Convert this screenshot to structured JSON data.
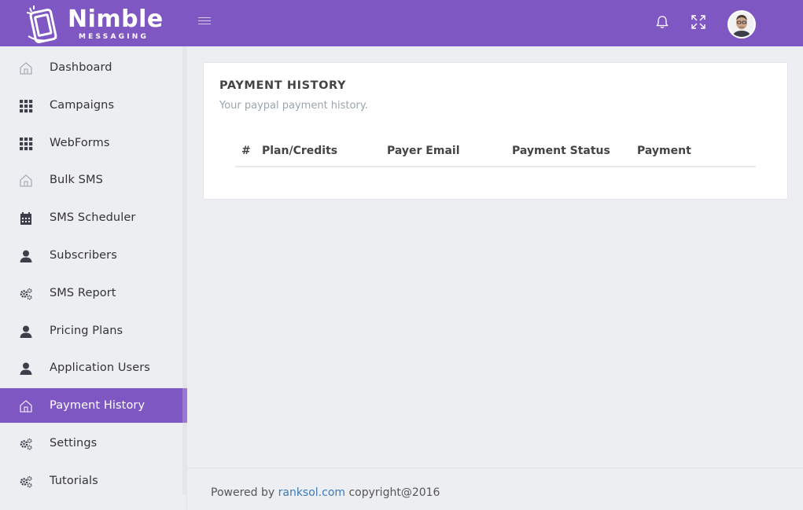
{
  "header": {
    "brand": "Nimble",
    "brand_sub": "MESSAGING",
    "icons": [
      "menu-icon",
      "bell-icon",
      "fullscreen-icon"
    ],
    "accent_color": "#7f57c2"
  },
  "sidebar": {
    "items": [
      {
        "label": "Dashboard",
        "icon": "home-icon"
      },
      {
        "label": "Campaigns",
        "icon": "grid-icon"
      },
      {
        "label": "WebForms",
        "icon": "grid-icon"
      },
      {
        "label": "Bulk SMS",
        "icon": "home-icon"
      },
      {
        "label": "SMS Scheduler",
        "icon": "calendar-icon"
      },
      {
        "label": "Subscribers",
        "icon": "user-icon"
      },
      {
        "label": "SMS Report",
        "icon": "gears-icon"
      },
      {
        "label": "Pricing Plans",
        "icon": "user-icon"
      },
      {
        "label": "Application Users",
        "icon": "user-icon"
      },
      {
        "label": "Payment History",
        "icon": "home-icon",
        "active": true
      },
      {
        "label": "Settings",
        "icon": "gears-icon"
      },
      {
        "label": "Tutorials",
        "icon": "gears-icon"
      }
    ]
  },
  "main": {
    "title": "PAYMENT HISTORY",
    "subtitle": "Your paypal payment history.",
    "columns": [
      "#",
      "Plan/Credits",
      "Payer Email",
      "Payment Status",
      "Payment"
    ]
  },
  "footer": {
    "prefix": "Powered by",
    "link": "ranksol.com",
    "suffix": "copyright@2016"
  }
}
